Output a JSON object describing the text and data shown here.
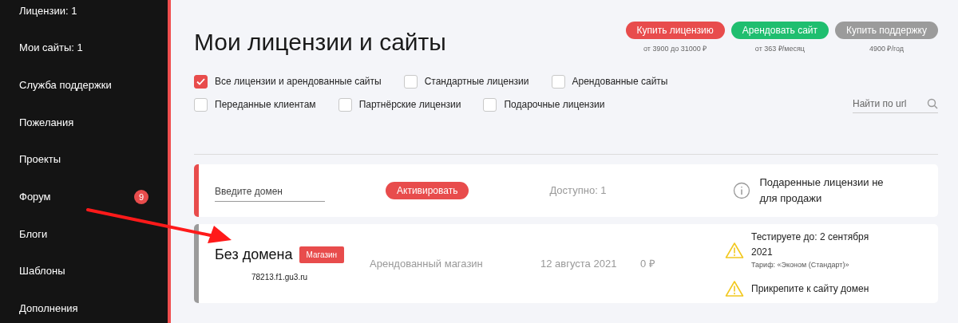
{
  "sidebar": {
    "items": [
      {
        "label": "Лицензии: 1"
      },
      {
        "label": "Мои сайты: 1"
      },
      {
        "label": "Служба поддержки"
      },
      {
        "label": "Пожелания"
      },
      {
        "label": "Проекты"
      },
      {
        "label": "Форум",
        "badge": "9"
      },
      {
        "label": "Блоги"
      },
      {
        "label": "Шаблоны"
      },
      {
        "label": "Дополнения"
      }
    ]
  },
  "title": "Мои лицензии и сайты",
  "actions": [
    {
      "label": "Купить лицензию",
      "note": "от 3900 до 31000 ₽",
      "color": "#e84c4c"
    },
    {
      "label": "Арендовать сайт",
      "note": "от 363 ₽/месяц",
      "color": "#1fbe6f"
    },
    {
      "label": "Купить поддержку",
      "note": "4900 ₽/год",
      "color": "#9b9b9b"
    }
  ],
  "filters": [
    [
      {
        "label": "Все лицензии и арендованные сайты",
        "checked": true
      },
      {
        "label": "Стандартные лицензии",
        "checked": false
      },
      {
        "label": "Арендованные сайты",
        "checked": false
      }
    ],
    [
      {
        "label": "Переданные клиентам",
        "checked": false
      },
      {
        "label": "Партнёрские лицензии",
        "checked": false
      },
      {
        "label": "Подарочные лицензии",
        "checked": false
      }
    ]
  ],
  "search": {
    "placeholder": "Найти по url"
  },
  "activation": {
    "placeholder": "Введите домен",
    "button": "Активировать",
    "available": "Доступно: 1",
    "info": "Подаренные лицензии не для продажи"
  },
  "sites": [
    {
      "name": "Без домена",
      "tag": "Магазин",
      "url": "78213.f1.gu3.ru",
      "type": "Арендованный магазин",
      "date": "12 августа 2021",
      "price": "0 ₽",
      "warnings": [
        {
          "text": "Тестируете до: 2 сентября 2021",
          "note": "Тариф: «Эконом (Стандарт)»"
        },
        {
          "text": "Прикрепите к сайту домен"
        }
      ]
    }
  ]
}
